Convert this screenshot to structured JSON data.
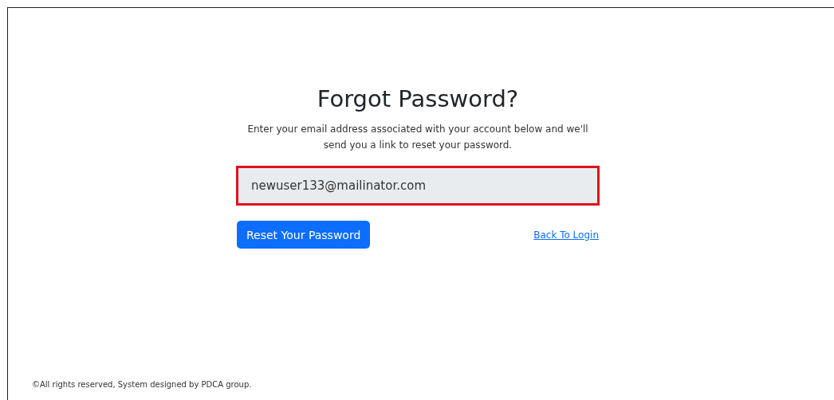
{
  "title": "Forgot Password?",
  "description": "Enter your email address associated with your account below and we'll send you a link to reset your password.",
  "email_field": {
    "value": "newuser133@mailinator.com",
    "highlighted": true
  },
  "reset_button": "Reset Your Password",
  "back_link": "Back To Login",
  "footer": "©All rights reserved, System designed by PDCA group."
}
